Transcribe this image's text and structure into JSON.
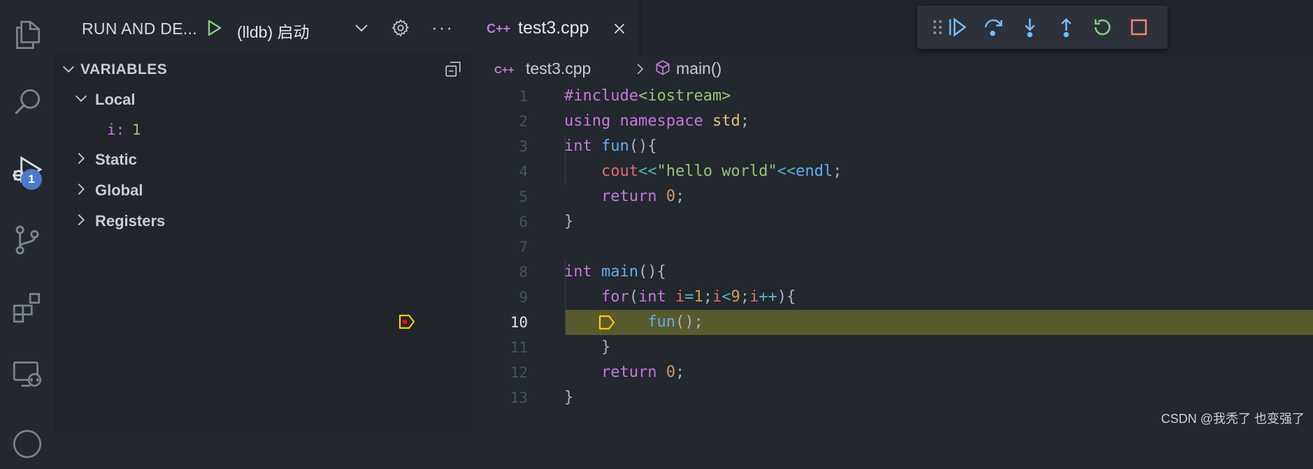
{
  "activity_bar": {
    "items": [
      {
        "name": "explorer",
        "icon": "files-icon"
      },
      {
        "name": "search",
        "icon": "search-icon"
      },
      {
        "name": "run-and-debug",
        "icon": "debug-icon",
        "badge": "1"
      },
      {
        "name": "source-control",
        "icon": "source-control-icon"
      },
      {
        "name": "extensions",
        "icon": "extensions-icon"
      },
      {
        "name": "remote-explorer",
        "icon": "remote-explorer-icon"
      }
    ]
  },
  "sidebar": {
    "title": "RUN AND DE...",
    "launch_config": "(lldb) 启动",
    "more": "···",
    "variables": {
      "header": "VARIABLES",
      "scopes": [
        "Local",
        "Static",
        "Global",
        "Registers"
      ],
      "local_vars": [
        {
          "name": "i:",
          "value": "1"
        }
      ]
    }
  },
  "editor": {
    "tab": {
      "icon": "C++",
      "title": "test3.cpp"
    },
    "breadcrumb": {
      "icon": "C++",
      "file": "test3.cpp",
      "symbol": "main()"
    },
    "current_line": 10,
    "line_numbers": [
      "1",
      "2",
      "3",
      "4",
      "5",
      "6",
      "7",
      "8",
      "9",
      "10",
      "11",
      "12",
      "13"
    ]
  },
  "debug_toolbar": [
    "drag-handle-icon",
    "continue-icon",
    "step-over-icon",
    "step-into-icon",
    "step-out-icon",
    "restart-icon",
    "stop-icon"
  ],
  "colors": {
    "background": "#23272e",
    "sidebar": "#21252b",
    "current_line_highlight": "#585a2e",
    "badge": "#4d78cc",
    "keyword": "#c678dd",
    "function": "#61afef",
    "string": "#98c379",
    "number": "#d19a66"
  },
  "watermark": "CSDN @我秃了 也变强了"
}
